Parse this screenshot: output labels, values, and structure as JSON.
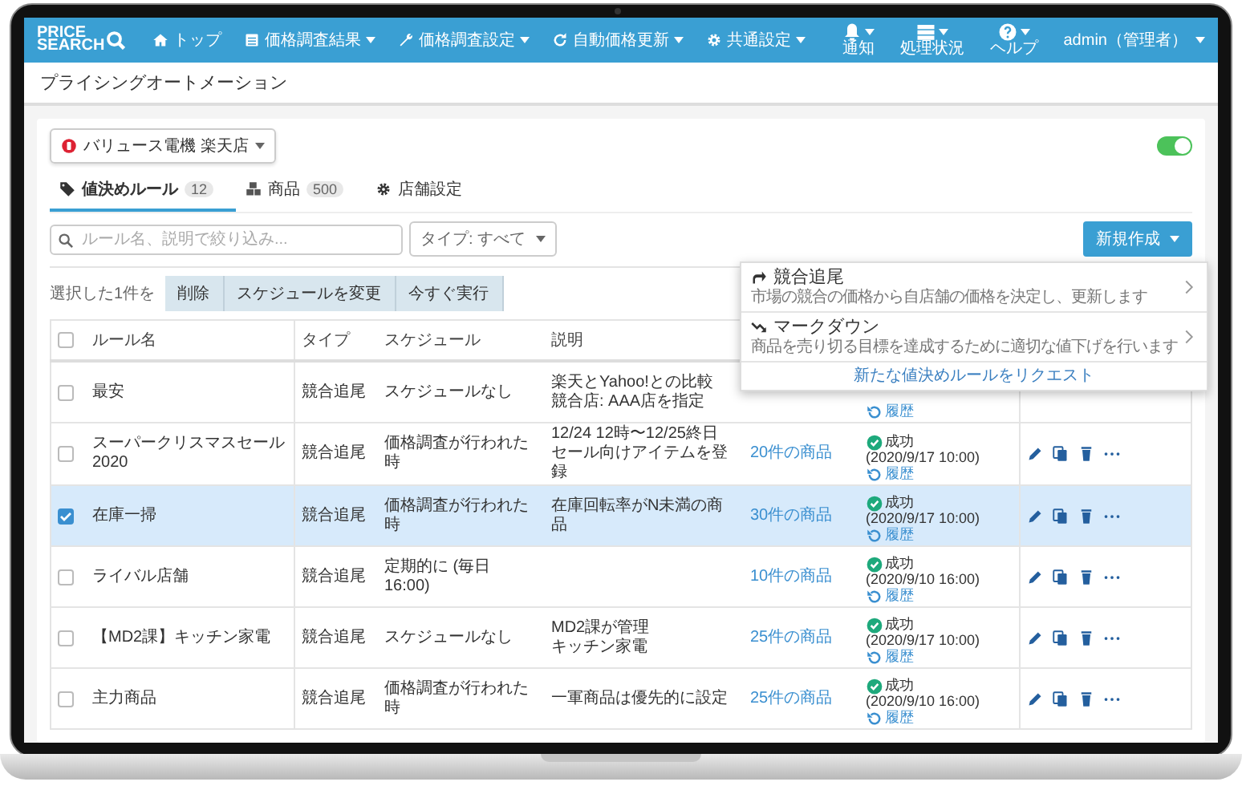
{
  "logo": {
    "line1": "PRICE",
    "line2": "SEARCH"
  },
  "nav": [
    {
      "label": "トップ",
      "kind": "home",
      "caret": false
    },
    {
      "label": "価格調査結果",
      "kind": "list",
      "caret": true
    },
    {
      "label": "価格調査設定",
      "kind": "wrench",
      "caret": true
    },
    {
      "label": "自動価格更新",
      "kind": "refresh",
      "caret": true
    },
    {
      "label": "共通設定",
      "kind": "gear",
      "caret": true
    }
  ],
  "nav_right": [
    {
      "label": "通知",
      "kind": "bell"
    },
    {
      "label": "処理状況",
      "kind": "server"
    },
    {
      "label": "ヘルプ",
      "kind": "help"
    }
  ],
  "user": "admin（管理者）",
  "page_title": "プライシングオートメーション",
  "store_select": {
    "value": "バリュース電機 楽天店"
  },
  "toggle": {
    "on": true
  },
  "tabs": [
    {
      "label": "値決めルール",
      "count": "12",
      "kind": "tag",
      "selected": true
    },
    {
      "label": "商品",
      "count": "500",
      "kind": "cubes",
      "selected": false
    },
    {
      "label": "店舗設定",
      "kind": "gear",
      "selected": false
    }
  ],
  "search": {
    "placeholder": "ルール名、説明で絞り込み..."
  },
  "type_filter": {
    "value": "タイプ: すべて"
  },
  "create_button": "新規作成",
  "bulk": {
    "label": "選択した1件を",
    "buttons": [
      "削除",
      "スケジュールを変更",
      "今すぐ実行"
    ]
  },
  "table": {
    "select_all": {
      "checked": false
    },
    "columns": [
      "ルール名",
      "タイプ",
      "スケジュール",
      "説明"
    ],
    "rows": [
      {
        "selected": false,
        "name": "最安",
        "type": "競合追尾",
        "schedule": "スケジュールなし",
        "description": [
          "楽天とYahoo!との比較",
          "競合店: AAA店を指定"
        ],
        "status": {
          "history": "履歴"
        }
      },
      {
        "selected": false,
        "name": "スーパークリスマスセール 2020",
        "type": "競合追尾",
        "schedule": "価格調査が行われた時",
        "description": [
          "12/24 12時〜12/25終日",
          "セール向けアイテムを登録"
        ],
        "products": "20件の商品",
        "status": {
          "result": "成功",
          "time": "(2020/9/17 10:00)",
          "history": "履歴"
        }
      },
      {
        "selected": true,
        "name": "在庫一掃",
        "type": "競合追尾",
        "schedule": "価格調査が行われた時",
        "description": [
          "在庫回転率がN未満の商品"
        ],
        "products": "30件の商品",
        "status": {
          "result": "成功",
          "time": "(2020/9/17 10:00)",
          "history": "履歴"
        }
      },
      {
        "selected": false,
        "name": "ライバル店舗",
        "type": "競合追尾",
        "schedule": "定期的に (毎日 16:00)",
        "description": [],
        "products": "10件の商品",
        "status": {
          "result": "成功",
          "time": "(2020/9/10 16:00)",
          "history": "履歴"
        }
      },
      {
        "selected": false,
        "name": "【MD2課】キッチン家電",
        "type": "競合追尾",
        "schedule": "スケジュールなし",
        "description": [
          "MD2課が管理",
          "キッチン家電"
        ],
        "products": "25件の商品",
        "status": {
          "result": "成功",
          "time": "(2020/9/17 10:00)",
          "history": "履歴"
        }
      },
      {
        "selected": false,
        "name": "主力商品",
        "type": "競合追尾",
        "schedule": "価格調査が行われた時",
        "description": [
          "一軍商品は優先的に設定"
        ],
        "products": "25件の商品",
        "status": {
          "result": "成功",
          "time": "(2020/9/10 16:00)",
          "history": "履歴"
        }
      }
    ]
  },
  "create_menu": {
    "items": [
      {
        "kind": "follow",
        "title": "競合追尾",
        "text": "市場の競合の価格から自店舗の価格を決定し、更新します"
      },
      {
        "kind": "markdown",
        "title": "マークダウン",
        "text": "商品を売り切る目標を達成するために適切な値下げを行います"
      }
    ],
    "footer_link": "新たな値決めルールをリクエスト"
  }
}
